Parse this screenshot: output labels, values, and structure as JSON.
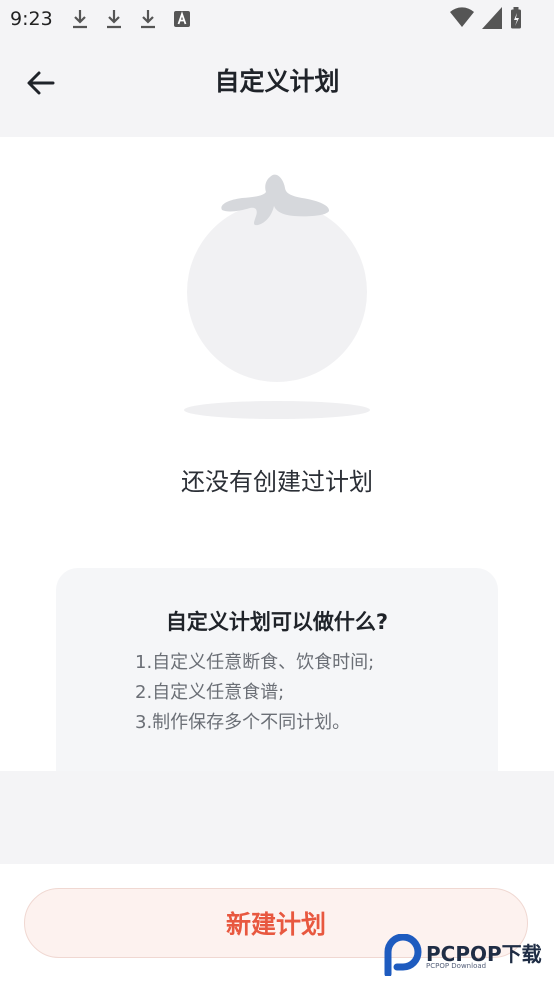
{
  "status_bar": {
    "time": "9:23",
    "icons_left": [
      "download-icon",
      "download-icon",
      "download-icon",
      "font-icon"
    ],
    "icons_right": [
      "wifi-icon",
      "signal-icon",
      "battery-icon"
    ]
  },
  "header": {
    "title": "自定义计划",
    "back_icon": "arrow-left-icon"
  },
  "empty_state": {
    "illustration": "tomato-illustration",
    "message": "还没有创建过计划"
  },
  "info": {
    "title": "自定义计划可以做什么?",
    "items": [
      "1.自定义任意断食、饮食时间;",
      "2.自定义任意食谱;",
      "3.制作保存多个不同计划。"
    ]
  },
  "footer": {
    "new_plan_label": "新建计划"
  },
  "watermark": {
    "brand": "PCPOP下载",
    "sub": "PCPOP Download"
  },
  "colors": {
    "accent": "#e8583f",
    "button_bg": "#fdf2ef",
    "page_bg": "#f4f4f6"
  }
}
